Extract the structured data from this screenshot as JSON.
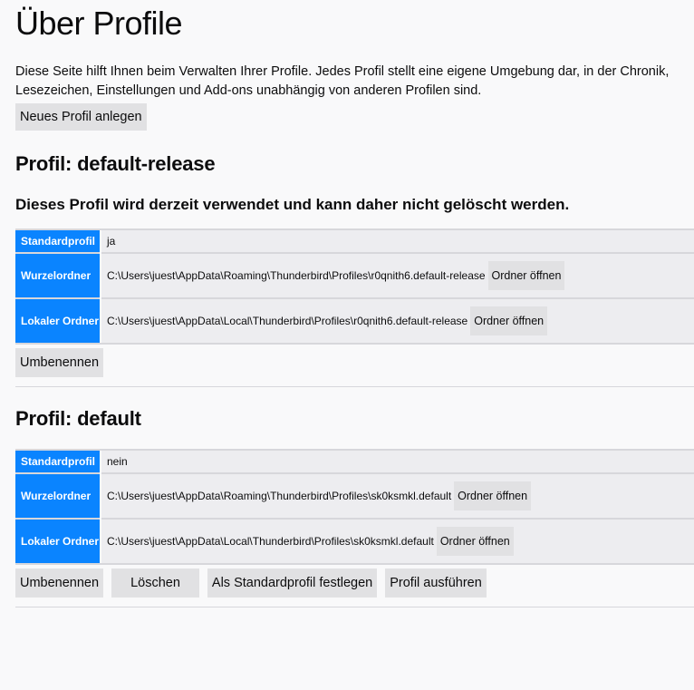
{
  "page": {
    "title": "Über Profile",
    "intro": "Diese Seite hilft Ihnen beim Verwalten Ihrer Profile. Jedes Profil stellt eine eigene Umgebung dar, in der Chronik, Lesezeichen, Einstellungen und Add-ons unabhängig von anderen Profilen sind.",
    "intro_line1": "Diese Seite hilft Ihnen beim Verwalten Ihrer Profile. Jedes Profil stellt eine eigene Umgebung dar, in der Chronik,",
    "intro_line2": "Lesezeichen, Einstellungen und Add-ons unabhängig von anderen Profilen sind.",
    "new_profile_button": "Neues Profil anlegen"
  },
  "profiles": [
    {
      "heading": "Profil: default-release",
      "in_use_notice": "Dieses Profil wird derzeit verwendet und kann daher nicht gelöscht werden.",
      "rows": {
        "default_label": "Standardprofil",
        "default_value": "ja",
        "root_label": "Wurzelordner",
        "root_path": "C:\\Users\\juest\\AppData\\Roaming\\Thunderbird\\Profiles\\r0qnith6.default-release",
        "local_label": "Lokaler Ordner",
        "local_path": "C:\\Users\\juest\\AppData\\Local\\Thunderbird\\Profiles\\r0qnith6.default-release",
        "open_folder": "Ordner öffnen"
      },
      "actions": {
        "rename": "Umbenennen"
      }
    },
    {
      "heading": "Profil: default",
      "rows": {
        "default_label": "Standardprofil",
        "default_value": "nein",
        "root_label": "Wurzelordner",
        "root_path": "C:\\Users\\juest\\AppData\\Roaming\\Thunderbird\\Profiles\\sk0ksmkl.default",
        "local_label": "Lokaler Ordner",
        "local_path": "C:\\Users\\juest\\AppData\\Local\\Thunderbird\\Profiles\\sk0ksmkl.default",
        "open_folder": "Ordner öffnen"
      },
      "actions": {
        "rename": "Umbenennen",
        "delete": "Löschen",
        "set_default": "Als Standardprofil festlegen",
        "launch": "Profil ausführen"
      }
    }
  ],
  "colors": {
    "key_cell_bg": "#0a84ff",
    "value_cell_bg": "#ededf0",
    "button_bg": "#e1e1e3",
    "page_bg": "#f9f9fa"
  }
}
